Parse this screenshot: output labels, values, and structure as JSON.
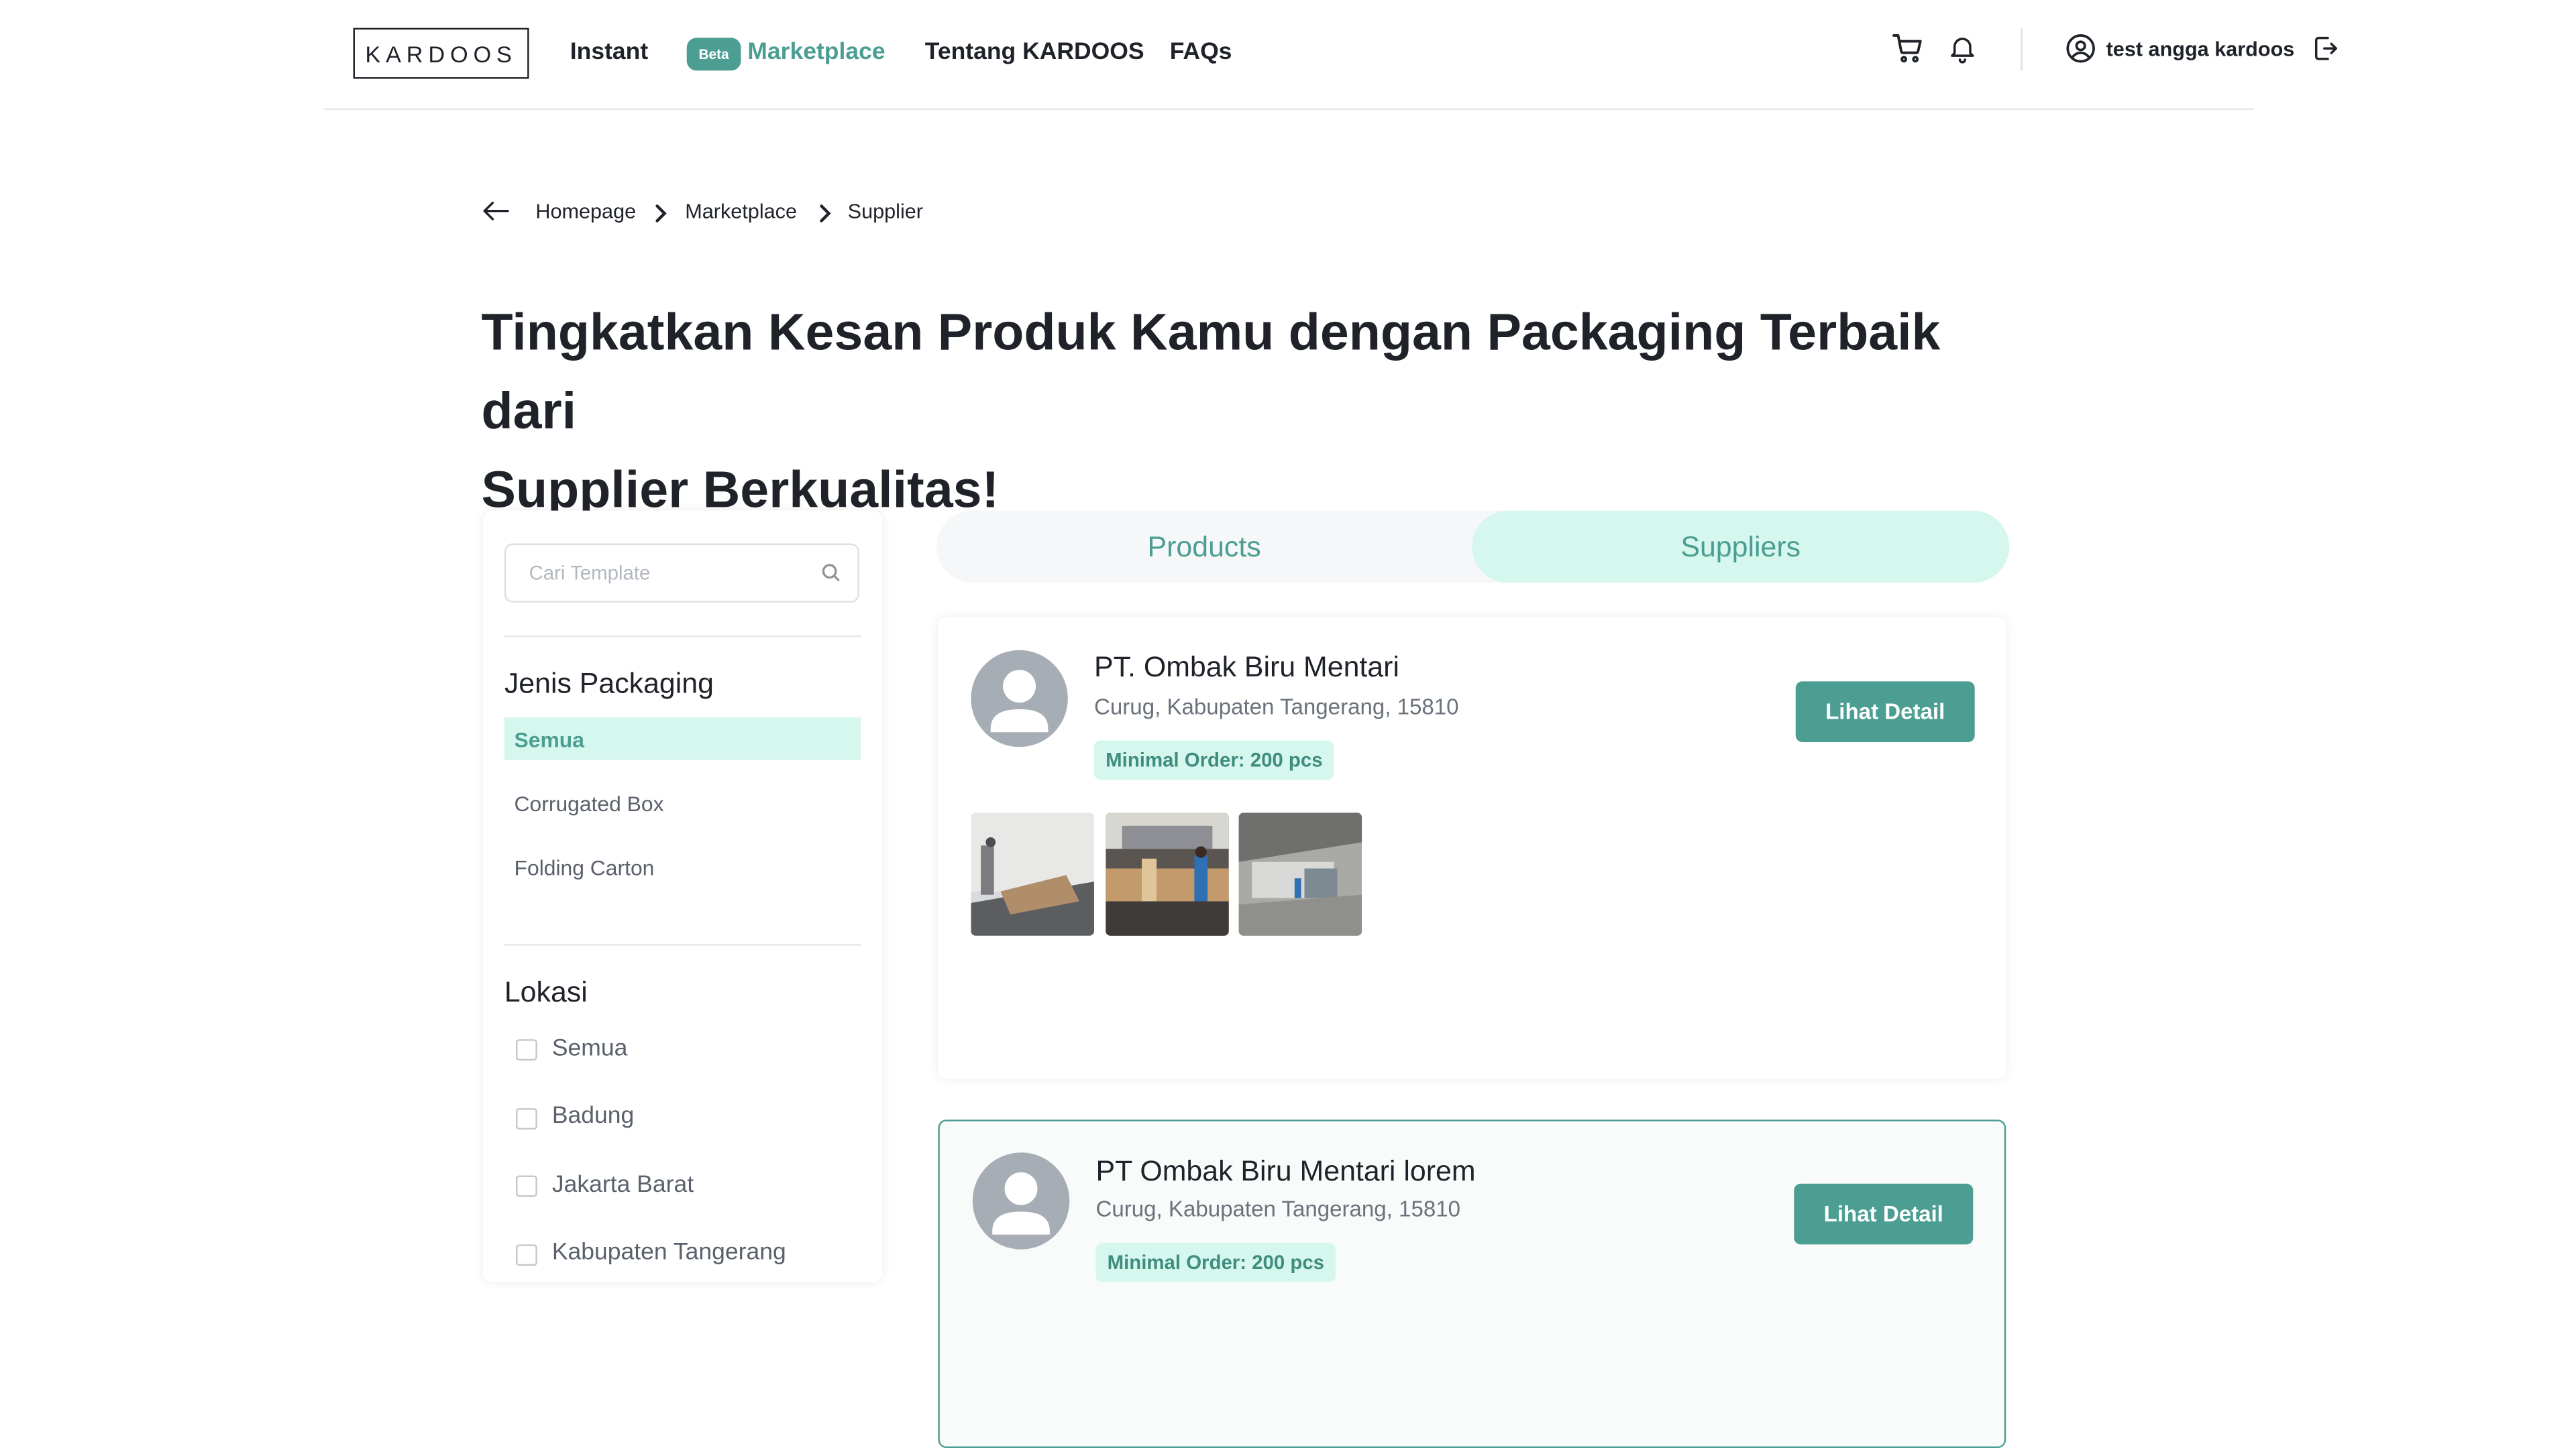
{
  "header": {
    "logo": "KARDOOS",
    "nav": {
      "instant": "Instant",
      "beta_badge": "Beta",
      "marketplace": "Marketplace",
      "tentang": "Tentang KARDOOS",
      "faqs": "FAQs"
    },
    "icons": [
      "cart-icon",
      "bell-icon",
      "user-circle-icon",
      "logout-icon"
    ],
    "user_name": "test angga kardoos"
  },
  "breadcrumb": {
    "back_icon": "arrow-left-icon",
    "items": [
      "Homepage",
      "Marketplace",
      "Supplier"
    ]
  },
  "headline": {
    "line1": "Tingkatkan Kesan Produk Kamu dengan Packaging Terbaik dari",
    "line2": "Supplier Berkualitas!"
  },
  "sidebar": {
    "search_placeholder": "Cari Template",
    "jenis_title": "Jenis Packaging",
    "jenis_items": [
      "Semua",
      "Corrugated Box",
      "Folding Carton"
    ],
    "jenis_selected": "Semua",
    "lokasi_title": "Lokasi",
    "lokasi_items": [
      "Semua",
      "Badung",
      "Jakarta Barat",
      "Kabupaten Tangerang"
    ]
  },
  "tabs": {
    "products": "Products",
    "suppliers": "Suppliers",
    "active": "Suppliers"
  },
  "suppliers": [
    {
      "name": "PT. Ombak Biru Mentari",
      "address": "Curug, Kabupaten Tangerang, 15810",
      "min_order": "Minimal Order: 200 pcs",
      "button": "Lihat Detail",
      "photos": [
        "workshop-photo",
        "factory-workers-photo",
        "machine-floor-photo"
      ]
    },
    {
      "name": "PT Ombak Biru Mentari lorem",
      "address": "Curug, Kabupaten Tangerang, 15810",
      "min_order": "Minimal Order: 200 pcs",
      "button": "Lihat Detail"
    }
  ],
  "colors": {
    "accent": "#4c9e92",
    "accent_light": "#d6f7ee",
    "text": "#1f2329",
    "muted": "#6b727b"
  }
}
